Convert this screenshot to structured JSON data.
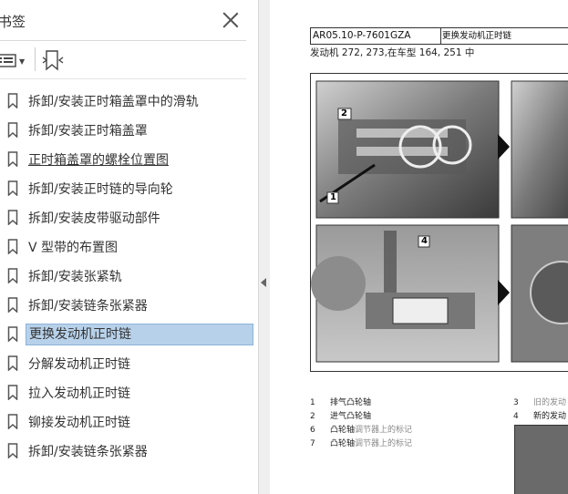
{
  "panel": {
    "title": "书签",
    "close_label": "×",
    "bookmarks": [
      {
        "label": "拆卸/安装正时箱盖罩中的滑轨",
        "selected": false,
        "link": false
      },
      {
        "label": "拆卸/安装正时箱盖罩",
        "selected": false,
        "link": false
      },
      {
        "label": "正时箱盖罩的螺栓位置图",
        "selected": false,
        "link": true
      },
      {
        "label": "拆卸/安装正时链的导向轮",
        "selected": false,
        "link": false
      },
      {
        "label": "拆卸/安装皮带驱动部件",
        "selected": false,
        "link": false
      },
      {
        "label": "V 型带的布置图",
        "selected": false,
        "link": false
      },
      {
        "label": "拆卸/安装张紧轨",
        "selected": false,
        "link": false
      },
      {
        "label": "拆卸/安装链条张紧器",
        "selected": false,
        "link": false
      },
      {
        "label": "更换发动机正时链",
        "selected": true,
        "link": false
      },
      {
        "label": "分解发动机正时链",
        "selected": false,
        "link": false
      },
      {
        "label": "拉入发动机正时链",
        "selected": false,
        "link": false
      },
      {
        "label": "铆接发动机正时链",
        "selected": false,
        "link": false
      },
      {
        "label": "拆卸/安装链条张紧器",
        "selected": false,
        "link": false
      }
    ],
    "icons": [
      "bookmark-icon",
      "list-options-icon",
      "find-bookmark-icon",
      "close-icon"
    ]
  },
  "document": {
    "doc_code": "AR05.10-P-7601GZA",
    "doc_title": "更换发动机正时链",
    "subtitle": "发动机    272, 273,在车型 164, 251 中",
    "callouts": [
      "2",
      "1",
      "4"
    ],
    "legend_left": [
      {
        "num": "1",
        "text": "排气凸轮轴",
        "faint": ""
      },
      {
        "num": "2",
        "text": "进气凸轮轴",
        "faint": ""
      },
      {
        "num": "6",
        "text": "凸轮轴",
        "faint": "调节器上的标记"
      },
      {
        "num": "7",
        "text": "凸轮轴",
        "faint": "调节器上的标记"
      }
    ],
    "legend_right": [
      {
        "num": "3",
        "text": "",
        "faint": "旧的发动"
      },
      {
        "num": "4",
        "text": "新的发动",
        "faint": ""
      }
    ]
  }
}
